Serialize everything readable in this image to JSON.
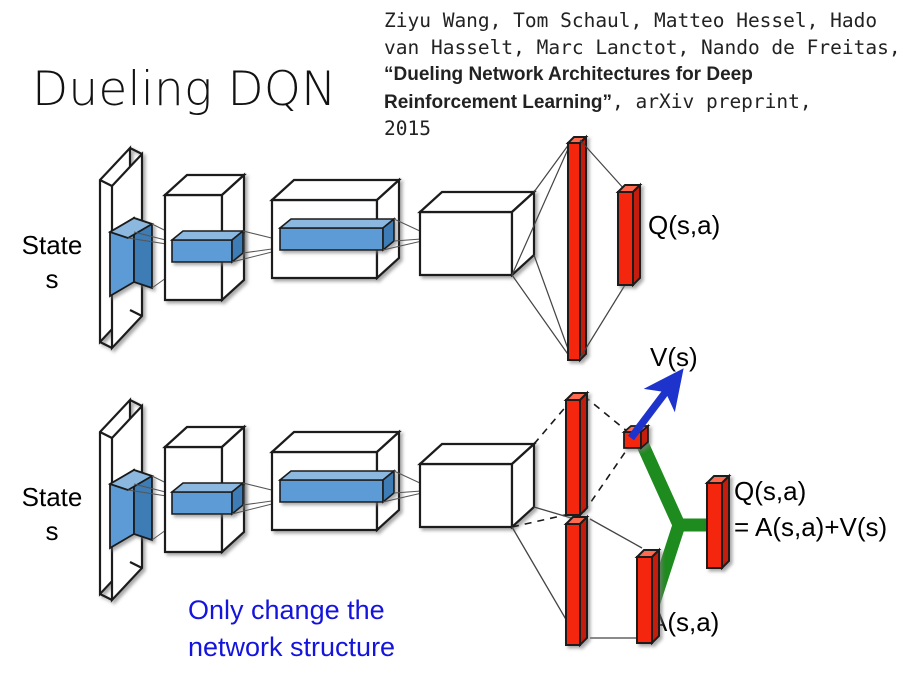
{
  "slide": {
    "title": "Dueling DQN",
    "background_color": "#FFFFFF"
  },
  "citation": {
    "authors_line_1": "Ziyu Wang, Tom Schaul, Matteo Hessel, Hado",
    "authors_line_2": "van Hasselt, Marc Lanctot, Nando de Freitas,",
    "paper_title_line_1": "“Dueling Network Architectures for Deep",
    "paper_title_line_2": "Reinforcement Learning”",
    "venue": ", arXiv preprint,",
    "year": "2015"
  },
  "note": {
    "line_1": "Only change the",
    "line_2": "network structure",
    "color": "#1414DC"
  },
  "networks": {
    "top": {
      "input_label": "State\ns",
      "output_label": "Q(s,a)"
    },
    "bottom": {
      "input_label": "State\ns",
      "value_label": "V(s)",
      "advantage_label": "A(s,a)",
      "output_label_line_1": "Q(s,a)",
      "output_label_line_2": "= A(s,a)+V(s)"
    }
  },
  "colors": {
    "filter_blue_face": "#5B9BD5",
    "filter_blue_top": "#8CB8DF",
    "filter_blue_side": "#3E7CB5",
    "fc_red_face": "#F4250E",
    "fc_red_top": "#FF6A50",
    "fc_red_side": "#C41C08",
    "merge_green": "#1E8B1E",
    "arrow_blue": "#1E33CC",
    "outline": "#1A1A1A",
    "connector": "#555555"
  }
}
